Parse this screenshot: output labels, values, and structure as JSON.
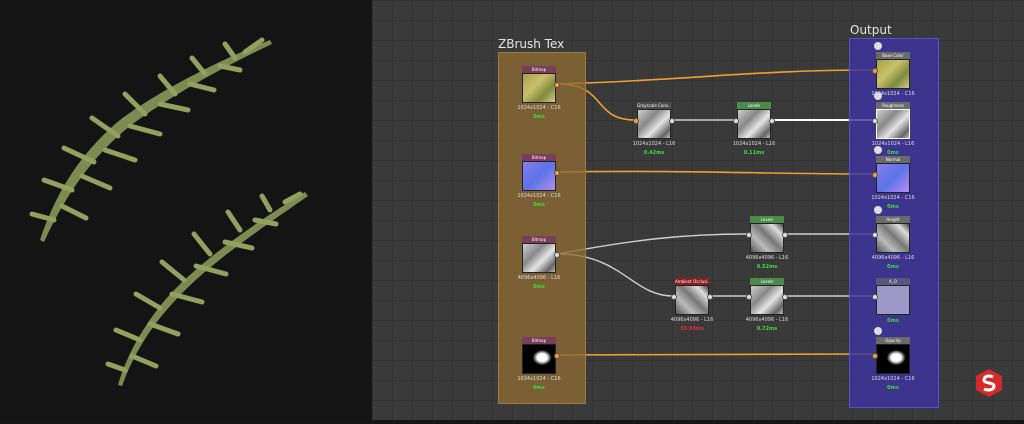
{
  "frames": {
    "zbrush": {
      "title": "ZBrush Tex"
    },
    "output": {
      "title": "Output"
    }
  },
  "nodes": {
    "bitmap1": {
      "header": "Bitmap",
      "res": "1024x1024 - C16",
      "time": "0ms"
    },
    "bitmap2": {
      "header": "Bitmap",
      "res": "1024x1024 - C16",
      "time": "0ms"
    },
    "bitmap3": {
      "header": "Bitmap",
      "res": "4096x4096 - L16",
      "time": "0ms"
    },
    "bitmap4": {
      "header": "Bitmap",
      "res": "1024x1024 - C16",
      "time": "0ms"
    },
    "grayscale": {
      "header": "Grayscale Conv...",
      "res": "1024x1024 - L16",
      "time": "0.42ms"
    },
    "levels1": {
      "header": "Levels",
      "res": "1024x1024 - L16",
      "time": "0.11ms"
    },
    "levels2": {
      "header": "Levels",
      "res": "4096x4096 - L16",
      "time": "0.52ms"
    },
    "ambient": {
      "header": "Ambient Occlusi...",
      "res": "4096x4096 - L16",
      "time": "39.98ms"
    },
    "levels3": {
      "header": "Levels",
      "res": "4096x4096 - L16",
      "time": "0.72ms"
    },
    "out_basecolor": {
      "header": "Base Color",
      "res": "1024x1024 - C16",
      "time": "0ms"
    },
    "out_roughness": {
      "header": "Roughness",
      "res": "1024x1024 - L16",
      "time": "0ms"
    },
    "out_normal": {
      "header": "Normal",
      "res": "1024x1024 - C16",
      "time": "0ms"
    },
    "out_height": {
      "header": "Height",
      "res": "4096x4096 - L16",
      "time": "0ms"
    },
    "out_ao": {
      "header": "A_O",
      "res": "",
      "time": "0ms"
    },
    "out_opacity": {
      "header": "Opacity",
      "res": "1024x1024 - C16",
      "time": "0ms"
    }
  },
  "icons": {
    "logo": "substance-designer-logo",
    "output-node": "output-node-icon"
  },
  "colors": {
    "orange_wire": "#f0a030",
    "white_wire": "#cfcfcf",
    "zbrush_frame": "#8e6b34",
    "output_frame": "#3e34a0",
    "green_time": "#3fdc3f",
    "red_time": "#e03030"
  }
}
